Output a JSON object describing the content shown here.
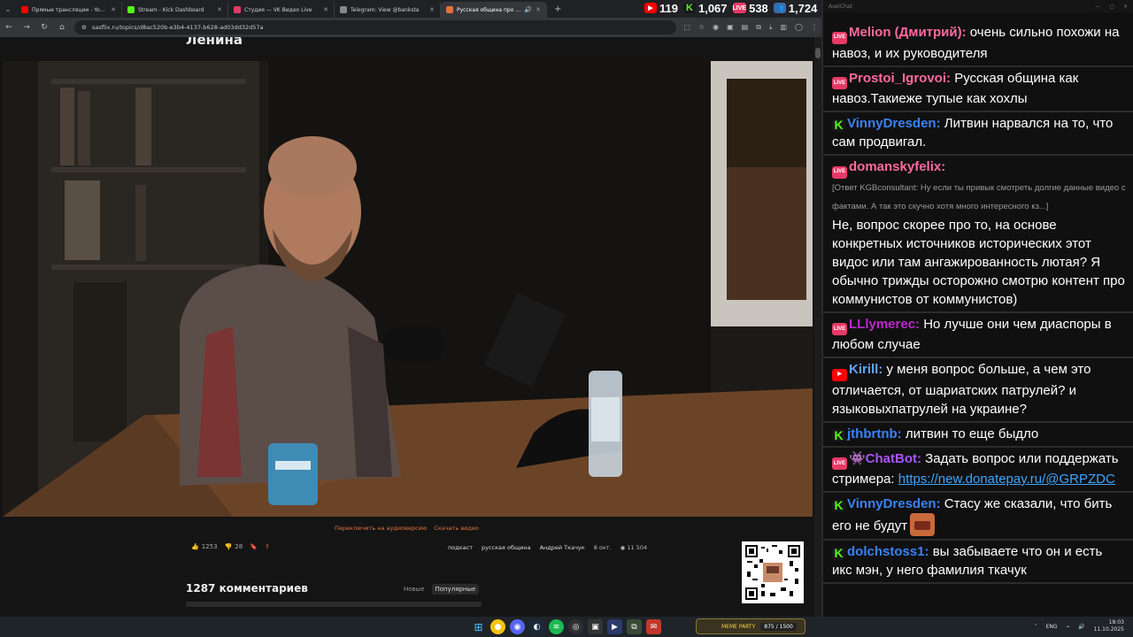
{
  "browser": {
    "tabs": [
      {
        "label": "Прямые трансляции - YouTub",
        "color": "#ff0000",
        "active": false
      },
      {
        "label": "Stream - Kick Dashboard",
        "color": "#53fc18",
        "active": false
      },
      {
        "label": "Студия — VK Видео Live",
        "color": "#e63a66",
        "active": false
      },
      {
        "label": "Telegram: View @banksta",
        "color": "#888888",
        "active": false
      },
      {
        "label": "Русская община про мигр",
        "color": "#e0733a",
        "active": true
      }
    ],
    "url": "sasflix.ru/topics/d8ac520b-e3b4-4137-b628-ad03dd32d57a"
  },
  "stats": [
    {
      "icon": "youtube-icon",
      "value": "119",
      "color": "#ff0000",
      "glyph": "▶"
    },
    {
      "icon": "kick-icon",
      "value": "1,067",
      "color": "#18181b",
      "glyph": "K"
    },
    {
      "icon": "vk-live-icon",
      "value": "538",
      "color": "#e63a66",
      "glyph": "LIVE"
    },
    {
      "icon": "viewers-icon",
      "value": "1,724",
      "color": "#3a6ea5",
      "glyph": "👥"
    }
  ],
  "page": {
    "title": "Ленина",
    "switch_audio": "Переключить на аудиоверсию",
    "download": "Скачать видео",
    "likes": "1253",
    "dislikes": "28",
    "tags": [
      "подкаст",
      "русская община",
      "Андрей Ткачук"
    ],
    "date": "8 окт.",
    "views": "11 504",
    "comments_title": "1287 комментариев",
    "sort_new": "Новые",
    "sort_popular": "Популярные"
  },
  "chat": {
    "window_title": "AxelChat",
    "messages": [
      {
        "platform": "vk",
        "user": "Melion (Дмитрий):",
        "color": "#ff6aa0",
        "text": "очень сильно похожи на навоз, и их руководителя"
      },
      {
        "platform": "vk",
        "user": "Prostoi_Igrovoi:",
        "color": "#ff6aa0",
        "text": "Русская община как навоз.Такиеже тупые как хохлы"
      },
      {
        "platform": "kick",
        "user": "VinnyDresden:",
        "color": "#3b82f6",
        "text": "Литвин нарвался на то, что сам продвигал."
      },
      {
        "platform": "vk",
        "user": "domanskyfelix:",
        "color": "#ff6aa0",
        "quote": "[Ответ KGBconsultant: Ну если ты привык смотреть долгие данные видео с фактами. А так это скучно хотя много интересного кз...]",
        "text": "Не, вопрос скорее про то, на основе конкретных источников исторических этот видос или там ангажированность лютая? Я обычно трижды осторожно смотрю контент про коммунистов от коммунистов)"
      },
      {
        "platform": "vk",
        "user": "LLlymerec:",
        "color": "#c026d3",
        "text": "Но лучше они чем диаспоры в любом случае"
      },
      {
        "platform": "yt",
        "user": "Kirill:",
        "color": "#60a5fa",
        "text": "у меня вопрос больше, а чем это отличается, от шариатских патрулей? и языковыхпатрулей на украине?"
      },
      {
        "platform": "kick",
        "user": "jthbrtnb:",
        "color": "#3b82f6",
        "text": "литвин то еще быдло"
      },
      {
        "platform": "vk",
        "user": "👾ChatBot:",
        "color": "#a855f7",
        "text": "Задать вопрос или поддержать стримера:",
        "link": "https://new.donatepay.ru/@GRPZDC"
      },
      {
        "platform": "kick",
        "user": "VinnyDresden:",
        "color": "#3b82f6",
        "text": "Стасу же сказали, что бить его не будут",
        "emote": true
      },
      {
        "platform": "kick",
        "user": "dolchstoss1:",
        "color": "#3b82f6",
        "text": "вы забываете что он и есть икс мэн, у него фамилия ткачук"
      }
    ]
  },
  "taskbar": {
    "party_label": "MEME PARTY",
    "party_count": "875 / 1500",
    "lang": "ENG",
    "time": "18:03",
    "date": "11.10.2025"
  }
}
